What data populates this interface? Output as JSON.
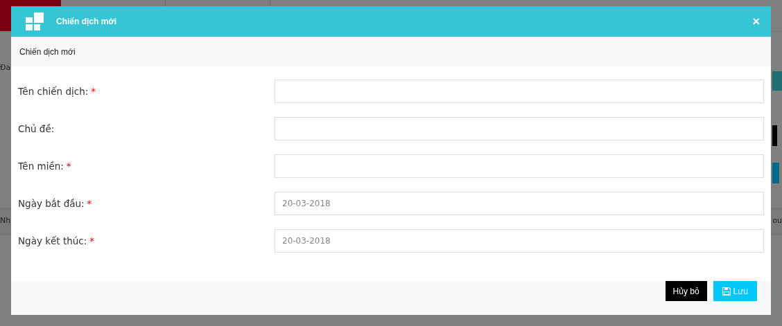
{
  "backdrop": {
    "texts": [
      "Đa",
      "Nh",
      "ou"
    ]
  },
  "dialog": {
    "title": "Chiến dịch mới",
    "close": "×",
    "subtitle": "Chiến dịch mới",
    "fields": [
      {
        "label": "Tên chiến dịch:",
        "marker": "*"
      },
      {
        "label": "Chủ đề:"
      },
      {
        "label": "Tên miền:",
        "marker": "*"
      },
      {
        "label": "Ngày bắt đầu:",
        "marker": "*",
        "placeholder": "20-03-2018"
      },
      {
        "label": "Ngày kết thúc:",
        "marker": "*",
        "placeholder": "20-03-2018"
      }
    ],
    "buttons": [
      {
        "label": "Hủy bỏ",
        "kind": "cancel"
      },
      {
        "label": "Lưu",
        "kind": "save"
      }
    ]
  }
}
